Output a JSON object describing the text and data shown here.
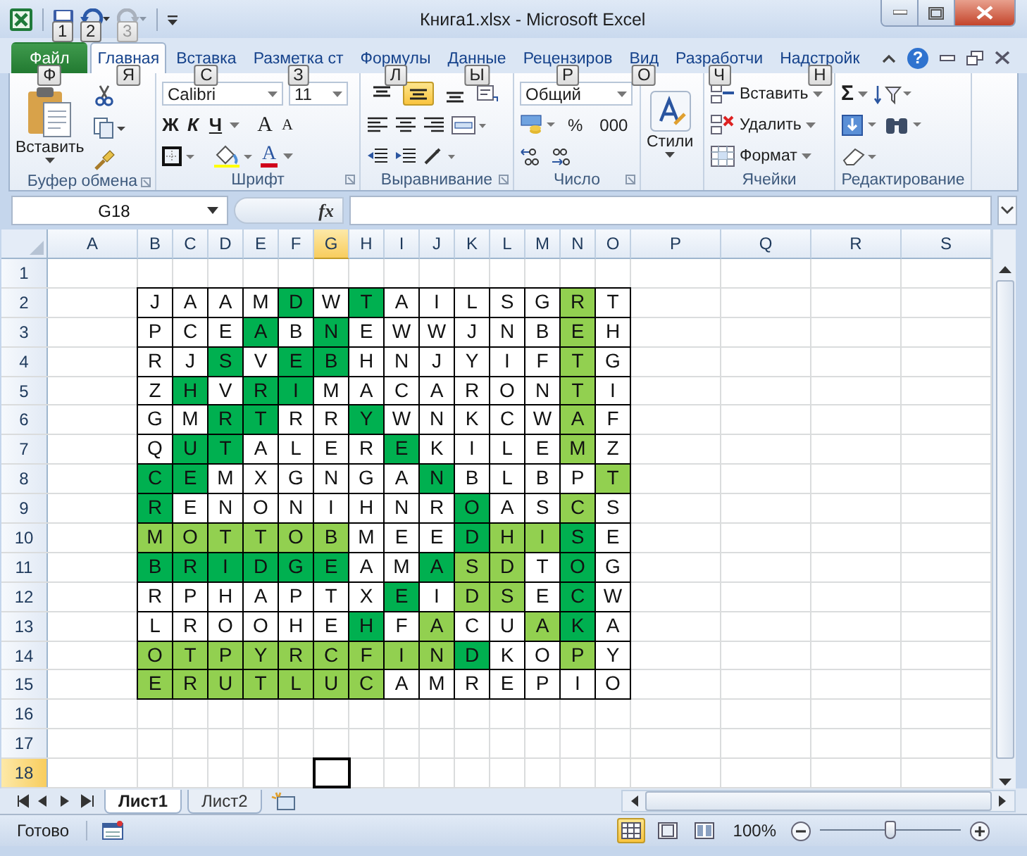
{
  "window": {
    "title": "Книга1.xlsx - Microsoft Excel"
  },
  "quick_access": [
    {
      "kind": "save",
      "keytip": "1",
      "disabled": false
    },
    {
      "kind": "undo",
      "keytip": "2",
      "disabled": false
    },
    {
      "kind": "redo",
      "keytip": "3",
      "disabled": true
    }
  ],
  "ribbon_tabs": [
    {
      "label": "Файл",
      "keytip": "Ф",
      "kind": "file",
      "selected": false
    },
    {
      "label": "Главная",
      "keytip": "Я",
      "kind": "tab",
      "selected": true
    },
    {
      "label": "Вставка",
      "keytip": "С",
      "kind": "tab",
      "selected": false
    },
    {
      "label": "Разметка ст",
      "keytip": "З",
      "kind": "tab",
      "selected": false
    },
    {
      "label": "Формулы",
      "keytip": "Л",
      "kind": "tab",
      "selected": false
    },
    {
      "label": "Данные",
      "keytip": "Ы",
      "kind": "tab",
      "selected": false
    },
    {
      "label": "Рецензиров",
      "keytip": "Р",
      "kind": "tab",
      "selected": false
    },
    {
      "label": "Вид",
      "keytip": "О",
      "kind": "tab",
      "selected": false
    },
    {
      "label": "Разработчи",
      "keytip": "Ч",
      "kind": "tab",
      "selected": false
    },
    {
      "label": "Надстройк",
      "keytip": "Н",
      "kind": "tab",
      "selected": false
    }
  ],
  "help": "?",
  "clipboard": {
    "label": "Буфер обмена",
    "paste": "Вставить"
  },
  "font": {
    "label": "Шрифт",
    "family": "Calibri",
    "size": "11",
    "bold": "Ж",
    "italic": "К",
    "underline": "Ч",
    "grow": "A",
    "shrink": "A",
    "color_button": "A"
  },
  "alignment": {
    "label": "Выравнивание",
    "vertical": [
      {
        "kind": "top",
        "selected": false
      },
      {
        "kind": "middle",
        "selected": true
      },
      {
        "kind": "bottom",
        "selected": false
      }
    ]
  },
  "number": {
    "label": "Число",
    "format": "Общий",
    "percent": "%",
    "thousands": "000"
  },
  "styles": {
    "label": "Стили"
  },
  "cells": {
    "label": "Ячейки",
    "buttons": [
      {
        "kind": "insert",
        "label": "Вставить"
      },
      {
        "kind": "delete",
        "label": "Удалить"
      },
      {
        "kind": "format",
        "label": "Формат"
      }
    ]
  },
  "editing": {
    "label": "Редактирование",
    "sum": "Σ"
  },
  "formula_bar": {
    "name_box": "G18",
    "function_button": "fx"
  },
  "columns": [
    {
      "label": "A",
      "selected": false
    },
    {
      "label": "B",
      "selected": false
    },
    {
      "label": "C",
      "selected": false
    },
    {
      "label": "D",
      "selected": false
    },
    {
      "label": "E",
      "selected": false
    },
    {
      "label": "F",
      "selected": false
    },
    {
      "label": "G",
      "selected": true
    },
    {
      "label": "H",
      "selected": false
    },
    {
      "label": "I",
      "selected": false
    },
    {
      "label": "J",
      "selected": false
    },
    {
      "label": "K",
      "selected": false
    },
    {
      "label": "L",
      "selected": false
    },
    {
      "label": "M",
      "selected": false
    },
    {
      "label": "N",
      "selected": false
    },
    {
      "label": "O",
      "selected": false
    },
    {
      "label": "P",
      "selected": false
    },
    {
      "label": "Q",
      "selected": false
    },
    {
      "label": "R",
      "selected": false
    },
    {
      "label": "S",
      "selected": false
    }
  ],
  "rows": [
    {
      "label": "1",
      "selected": false
    },
    {
      "label": "2",
      "selected": false,
      "cells": [
        {
          "text": "J"
        },
        {
          "text": "A"
        },
        {
          "text": "A"
        },
        {
          "text": "M"
        },
        {
          "text": "D",
          "color": "#00b050"
        },
        {
          "text": "W"
        },
        {
          "text": "T",
          "color": "#00b050"
        },
        {
          "text": "A"
        },
        {
          "text": "I"
        },
        {
          "text": "L"
        },
        {
          "text": "S"
        },
        {
          "text": "G"
        },
        {
          "text": "R",
          "color": "#92d050"
        },
        {
          "text": "T"
        }
      ]
    },
    {
      "label": "3",
      "selected": false,
      "cells": [
        {
          "text": "P"
        },
        {
          "text": "C"
        },
        {
          "text": "E"
        },
        {
          "text": "A",
          "color": "#00b050"
        },
        {
          "text": "B"
        },
        {
          "text": "N",
          "color": "#00b050"
        },
        {
          "text": "E"
        },
        {
          "text": "W"
        },
        {
          "text": "W"
        },
        {
          "text": "J"
        },
        {
          "text": "N"
        },
        {
          "text": "B"
        },
        {
          "text": "E",
          "color": "#92d050"
        },
        {
          "text": "H"
        }
      ]
    },
    {
      "label": "4",
      "selected": false,
      "cells": [
        {
          "text": "R"
        },
        {
          "text": "J"
        },
        {
          "text": "S",
          "color": "#00b050"
        },
        {
          "text": "V"
        },
        {
          "text": "E",
          "color": "#00b050"
        },
        {
          "text": "B",
          "color": "#00b050"
        },
        {
          "text": "H"
        },
        {
          "text": "N"
        },
        {
          "text": "J"
        },
        {
          "text": "Y"
        },
        {
          "text": "I"
        },
        {
          "text": "F"
        },
        {
          "text": "T",
          "color": "#92d050"
        },
        {
          "text": "G"
        }
      ]
    },
    {
      "label": "5",
      "selected": false,
      "cells": [
        {
          "text": "Z"
        },
        {
          "text": "H",
          "color": "#00b050"
        },
        {
          "text": "V"
        },
        {
          "text": "R",
          "color": "#00b050"
        },
        {
          "text": "I",
          "color": "#00b050"
        },
        {
          "text": "M"
        },
        {
          "text": "A"
        },
        {
          "text": "C"
        },
        {
          "text": "A"
        },
        {
          "text": "R"
        },
        {
          "text": "O"
        },
        {
          "text": "N"
        },
        {
          "text": "T",
          "color": "#92d050"
        },
        {
          "text": "I"
        }
      ]
    },
    {
      "label": "6",
      "selected": false,
      "cells": [
        {
          "text": "G"
        },
        {
          "text": "M"
        },
        {
          "text": "R",
          "color": "#00b050"
        },
        {
          "text": "T",
          "color": "#00b050"
        },
        {
          "text": "R"
        },
        {
          "text": "R"
        },
        {
          "text": "Y",
          "color": "#00b050"
        },
        {
          "text": "W"
        },
        {
          "text": "N"
        },
        {
          "text": "K"
        },
        {
          "text": "C"
        },
        {
          "text": "W"
        },
        {
          "text": "A",
          "color": "#92d050"
        },
        {
          "text": "F"
        }
      ]
    },
    {
      "label": "7",
      "selected": false,
      "cells": [
        {
          "text": "Q"
        },
        {
          "text": "U",
          "color": "#00b050"
        },
        {
          "text": "T",
          "color": "#00b050"
        },
        {
          "text": "A"
        },
        {
          "text": "L"
        },
        {
          "text": "E"
        },
        {
          "text": "R"
        },
        {
          "text": "E",
          "color": "#00b050"
        },
        {
          "text": "K"
        },
        {
          "text": "I"
        },
        {
          "text": "L"
        },
        {
          "text": "E"
        },
        {
          "text": "M",
          "color": "#92d050"
        },
        {
          "text": "Z"
        }
      ]
    },
    {
      "label": "8",
      "selected": false,
      "cells": [
        {
          "text": "C",
          "color": "#00b050"
        },
        {
          "text": "E",
          "color": "#00b050"
        },
        {
          "text": "M"
        },
        {
          "text": "X"
        },
        {
          "text": "G"
        },
        {
          "text": "N"
        },
        {
          "text": "G"
        },
        {
          "text": "A"
        },
        {
          "text": "N",
          "color": "#00b050"
        },
        {
          "text": "B"
        },
        {
          "text": "L"
        },
        {
          "text": "B"
        },
        {
          "text": "P"
        },
        {
          "text": "T",
          "color": "#92d050"
        }
      ]
    },
    {
      "label": "9",
      "selected": false,
      "cells": [
        {
          "text": "R",
          "color": "#00b050"
        },
        {
          "text": "E"
        },
        {
          "text": "N"
        },
        {
          "text": "O"
        },
        {
          "text": "N"
        },
        {
          "text": "I"
        },
        {
          "text": "H"
        },
        {
          "text": "N"
        },
        {
          "text": "R"
        },
        {
          "text": "O",
          "color": "#00b050"
        },
        {
          "text": "A"
        },
        {
          "text": "S"
        },
        {
          "text": "C",
          "color": "#92d050"
        },
        {
          "text": "S"
        }
      ]
    },
    {
      "label": "10",
      "selected": false,
      "cells": [
        {
          "text": "M",
          "color": "#92d050"
        },
        {
          "text": "O",
          "color": "#92d050"
        },
        {
          "text": "T",
          "color": "#92d050"
        },
        {
          "text": "T",
          "color": "#92d050"
        },
        {
          "text": "O",
          "color": "#92d050"
        },
        {
          "text": "B",
          "color": "#92d050"
        },
        {
          "text": "M"
        },
        {
          "text": "E"
        },
        {
          "text": "E"
        },
        {
          "text": "D",
          "color": "#00b050"
        },
        {
          "text": "H",
          "color": "#92d050"
        },
        {
          "text": "I",
          "color": "#92d050"
        },
        {
          "text": "S",
          "color": "#00b050"
        },
        {
          "text": "E"
        }
      ]
    },
    {
      "label": "11",
      "selected": false,
      "cells": [
        {
          "text": "B",
          "color": "#00b050"
        },
        {
          "text": "R",
          "color": "#00b050"
        },
        {
          "text": "I",
          "color": "#00b050"
        },
        {
          "text": "D",
          "color": "#00b050"
        },
        {
          "text": "G",
          "color": "#00b050"
        },
        {
          "text": "E",
          "color": "#00b050"
        },
        {
          "text": "A"
        },
        {
          "text": "M"
        },
        {
          "text": "A",
          "color": "#00b050"
        },
        {
          "text": "S",
          "color": "#92d050"
        },
        {
          "text": "D",
          "color": "#92d050"
        },
        {
          "text": "T"
        },
        {
          "text": "O",
          "color": "#00b050"
        },
        {
          "text": "G"
        }
      ]
    },
    {
      "label": "12",
      "selected": false,
      "cells": [
        {
          "text": "R"
        },
        {
          "text": "P"
        },
        {
          "text": "H"
        },
        {
          "text": "A"
        },
        {
          "text": "P"
        },
        {
          "text": "T"
        },
        {
          "text": "X"
        },
        {
          "text": "E",
          "color": "#00b050"
        },
        {
          "text": "I"
        },
        {
          "text": "D",
          "color": "#92d050"
        },
        {
          "text": "S",
          "color": "#92d050"
        },
        {
          "text": "E"
        },
        {
          "text": "C",
          "color": "#00b050"
        },
        {
          "text": "W"
        }
      ]
    },
    {
      "label": "13",
      "selected": false,
      "cells": [
        {
          "text": "L"
        },
        {
          "text": "R"
        },
        {
          "text": "O"
        },
        {
          "text": "O"
        },
        {
          "text": "H"
        },
        {
          "text": "E"
        },
        {
          "text": "H",
          "color": "#00b050"
        },
        {
          "text": "F"
        },
        {
          "text": "A",
          "color": "#92d050"
        },
        {
          "text": "C"
        },
        {
          "text": "U"
        },
        {
          "text": "A",
          "color": "#92d050"
        },
        {
          "text": "K",
          "color": "#00b050"
        },
        {
          "text": "A"
        }
      ]
    },
    {
      "label": "14",
      "selected": false,
      "cells": [
        {
          "text": "O",
          "color": "#92d050"
        },
        {
          "text": "T",
          "color": "#92d050"
        },
        {
          "text": "P",
          "color": "#92d050"
        },
        {
          "text": "Y",
          "color": "#92d050"
        },
        {
          "text": "R",
          "color": "#92d050"
        },
        {
          "text": "C",
          "color": "#92d050"
        },
        {
          "text": "F",
          "color": "#92d050"
        },
        {
          "text": "I",
          "color": "#92d050"
        },
        {
          "text": "N",
          "color": "#92d050"
        },
        {
          "text": "D",
          "color": "#00b050"
        },
        {
          "text": "K"
        },
        {
          "text": "O"
        },
        {
          "text": "P",
          "color": "#92d050"
        },
        {
          "text": "Y"
        }
      ]
    },
    {
      "label": "15",
      "selected": false,
      "cells": [
        {
          "text": "E",
          "color": "#92d050"
        },
        {
          "text": "R",
          "color": "#92d050"
        },
        {
          "text": "U",
          "color": "#92d050"
        },
        {
          "text": "T",
          "color": "#92d050"
        },
        {
          "text": "L",
          "color": "#92d050"
        },
        {
          "text": "U",
          "color": "#92d050"
        },
        {
          "text": "C",
          "color": "#92d050"
        },
        {
          "text": "A"
        },
        {
          "text": "M"
        },
        {
          "text": "R"
        },
        {
          "text": "E"
        },
        {
          "text": "P"
        },
        {
          "text": "I"
        },
        {
          "text": "O"
        }
      ]
    },
    {
      "label": "16",
      "selected": false
    },
    {
      "label": "17",
      "selected": false
    },
    {
      "label": "18",
      "selected": true
    }
  ],
  "sheet_tabs": [
    {
      "label": "Лист1",
      "selected": true
    },
    {
      "label": "Лист2",
      "selected": false
    }
  ],
  "status_bar": {
    "text": "Готово",
    "views": [
      {
        "kind": "normal",
        "selected": true
      },
      {
        "kind": "layout",
        "selected": false
      },
      {
        "kind": "pagebreak",
        "selected": false
      }
    ],
    "zoom": "100%",
    "zoom_slider": {
      "level": 0.5
    }
  }
}
